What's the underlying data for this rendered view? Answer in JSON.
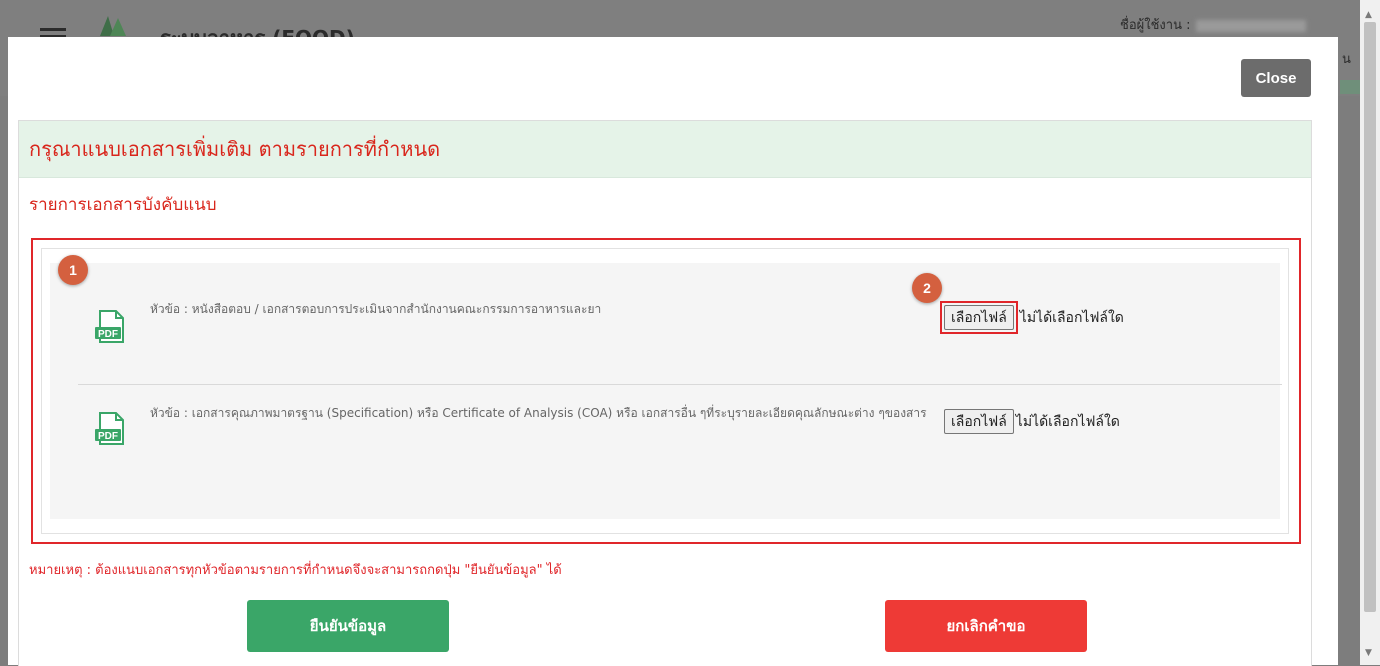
{
  "background": {
    "app_title": "ระบบอาหาร (FOOD)",
    "user_label": "ชื่อผู้ใช้งาน :",
    "edge_char": "น"
  },
  "modal": {
    "close_label": "Close",
    "heading": "กรุณาแนบเอกสารเพิ่มเติม ตามรายการที่กำหนด",
    "section_title": "รายการเอกสารบังคับแนบ",
    "documents": [
      {
        "title": "หัวข้อ : หนังสือตอบ / เอกสารตอบการประเมินจากสำนักงานคณะกรรมการอาหารและยา",
        "choose_file_label": "เลือกไฟล์",
        "file_status": "ไม่ได้เลือกไฟล์ใด",
        "icon": "pdf-icon"
      },
      {
        "title": "หัวข้อ : เอกสารคุณภาพมาตรฐาน (Specification) หรือ Certificate of Analysis (COA) หรือ เอกสารอื่น ๆที่ระบุรายละเอียดคุณลักษณะต่าง ๆของสาร",
        "choose_file_label": "เลือกไฟล์",
        "file_status": "ไม่ได้เลือกไฟล์ใด",
        "icon": "pdf-icon"
      }
    ],
    "annotation_1": "1",
    "annotation_2": "2",
    "note": "หมายเหตุ : ต้องแนบเอกสารทุกหัวข้อตามรายการที่กำหนดจึงจะสามารถกดปุ่ม \"ยืนยันข้อมูล\" ได้",
    "confirm_label": "ยืนยันข้อมูล",
    "cancel_label": "ยกเลิกคำขอ"
  },
  "colors": {
    "heading_text": "#d9261c",
    "heading_bg": "#e5f3e8",
    "confirm_bg": "#3aa668",
    "cancel_bg": "#ee3a36",
    "badge_bg": "#d4603f",
    "highlight": "#e0262a"
  }
}
